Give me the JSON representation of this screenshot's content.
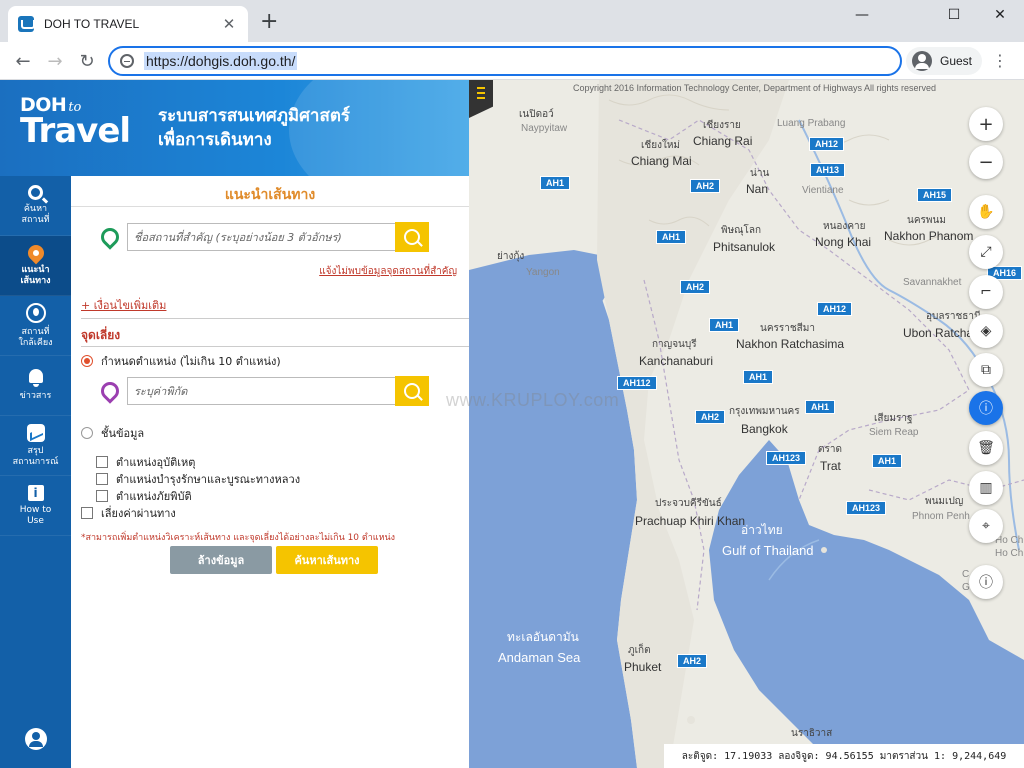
{
  "browser": {
    "tab_title": "DOH TO TRAVEL",
    "url": "https://dohgis.doh.go.th/",
    "profile": "Guest"
  },
  "header": {
    "logo_top": "DOH",
    "logo_to": "to",
    "logo_big": "Travel",
    "title_line1": "ระบบสารสนเทศภูมิศาสตร์",
    "title_line2": "เพื่อการเดินทาง"
  },
  "sidebar": {
    "items": [
      {
        "label1": "ค้นหา",
        "label2": "สถานที่",
        "icon": "search-icon"
      },
      {
        "label1": "แนะนำ",
        "label2": "เส้นทาง",
        "icon": "map-pin-icon",
        "active": true
      },
      {
        "label1": "สถานที่",
        "label2": "ใกล้เคียง",
        "icon": "nearby-icon"
      },
      {
        "label1": "ข่าวสาร",
        "label2": "",
        "icon": "bell-icon"
      },
      {
        "label1": "สรุป",
        "label2": "สถานการณ์",
        "icon": "chart-icon"
      },
      {
        "label1": "How to",
        "label2": "Use",
        "icon": "info-icon"
      }
    ]
  },
  "route_panel": {
    "title": "แนะนำเส้นทาง",
    "origin_placeholder": "ชื่อสถานที่สำคัญ (ระบุอย่างน้อย 3 ตัวอักษร)",
    "report_link": "แจ้งไม่พบข้อมูลจุดสถานที่สำคัญ",
    "more_conditions": "+ เงื่อนไขเพิ่มเติม",
    "avoid_label": "จุดเลี่ยง",
    "radio_position": "กำหนดตำแหน่ง (ไม่เกิน 10 ตำแหน่ง)",
    "coord_placeholder": "ระบุค่าพิกัด",
    "radio_layer": "ชั้นข้อมูล",
    "layers": [
      "ตำแหน่งอุบัติเหตุ",
      "ตำแหน่งบำรุงรักษาและบูรณะทางหลวง",
      "ตำแหน่งภัยพิบัติ"
    ],
    "avoid_toll": "เลี่ยงค่าผ่านทาง",
    "note": "*สามารถเพิ่มตำแหน่งวิเคราะห์เส้นทาง และจุดเลี่ยงได้อย่างละไม่เกิน 10 ตำแหน่ง",
    "clear_button": "ล้างข้อมูล",
    "search_button": "ค้นหาเส้นทาง"
  },
  "watermark": "www.KRUPLOY.com",
  "map": {
    "copyright": "Copyright 2016 Information Technology Center, Department of Highways All rights reserved",
    "places": [
      {
        "th": "เนปิดอว์",
        "en": "Naypyitaw",
        "style": "sm"
      },
      {
        "th": "เชียงใหม่",
        "en": "Chiang Mai",
        "style": "en"
      },
      {
        "th": "เชียงราย",
        "en": "Chiang Rai",
        "style": "en"
      },
      {
        "th": "",
        "en": "Luang Prabang",
        "style": "sm"
      },
      {
        "th": "น่าน",
        "en": "Nan",
        "style": "en"
      },
      {
        "th": "",
        "en": "Vientiane",
        "style": "sm"
      },
      {
        "th": "พิษณุโลก",
        "en": "Phitsanulok",
        "style": "en"
      },
      {
        "th": "หนองคาย",
        "en": "Nong Khai",
        "style": "en"
      },
      {
        "th": "นครพนม",
        "en": "Nakhon Phanom",
        "style": "en"
      },
      {
        "th": "ย่างกุ้ง",
        "en": "Yangon",
        "style": "sm"
      },
      {
        "th": "",
        "en": "Savannakhet",
        "style": "sm"
      },
      {
        "th": "อุบลราชธานี",
        "en": "Ubon Ratcha",
        "style": "en"
      },
      {
        "th": "กาญจนบุรี",
        "en": "Kanchanaburi",
        "style": "en"
      },
      {
        "th": "นครราชสีมา",
        "en": "Nakhon Ratchasima",
        "style": "en"
      },
      {
        "th": "กรุงเทพมหานคร",
        "en": "Bangkok",
        "style": "en"
      },
      {
        "th": "เสียมราฐ",
        "en": "Siem Reap",
        "style": "sm"
      },
      {
        "th": "ตราด",
        "en": "Trat",
        "style": "en"
      },
      {
        "th": "ประจวบคีรีขันธ์",
        "en": "Prachuap Khiri Khan",
        "style": "en"
      },
      {
        "th": "พนมเปญ",
        "en": "Phnom Penh",
        "style": "sm"
      },
      {
        "th": "ภูเก็ต",
        "en": "Phuket",
        "style": "en"
      },
      {
        "th": "นราธิวาส",
        "en": "",
        "style": "en"
      }
    ],
    "seas": [
      {
        "th": "อ่าวไทย",
        "en": "Gulf of Thailand"
      },
      {
        "th": "ทะเลอันดามัน",
        "en": "Andaman Sea"
      }
    ],
    "edge_labels": [
      "Ho Chi",
      "Ho Ch",
      "C",
      "G"
    ],
    "highways": [
      "AH1",
      "AH2",
      "AH12",
      "AH13",
      "AH15",
      "AH16",
      "AH1",
      "AH2",
      "AH12",
      "AH1",
      "AH112",
      "AH1",
      "AH2",
      "AH1",
      "AH123",
      "AH1",
      "AH123",
      "AH2"
    ],
    "controls": [
      "zoom-in-icon",
      "zoom-out-icon",
      "pan-hand-icon",
      "fullscreen-icon",
      "measure-icon",
      "layers-icon",
      "layers-add-icon",
      "info-icon",
      "trash-icon",
      "basemap-icon",
      "locate-icon",
      "feedback-icon"
    ],
    "coord_text": "ละติจูด: 17.19033 ลองจิจูด: 94.56155 มาตราส่วน 1: 9,244,649"
  }
}
